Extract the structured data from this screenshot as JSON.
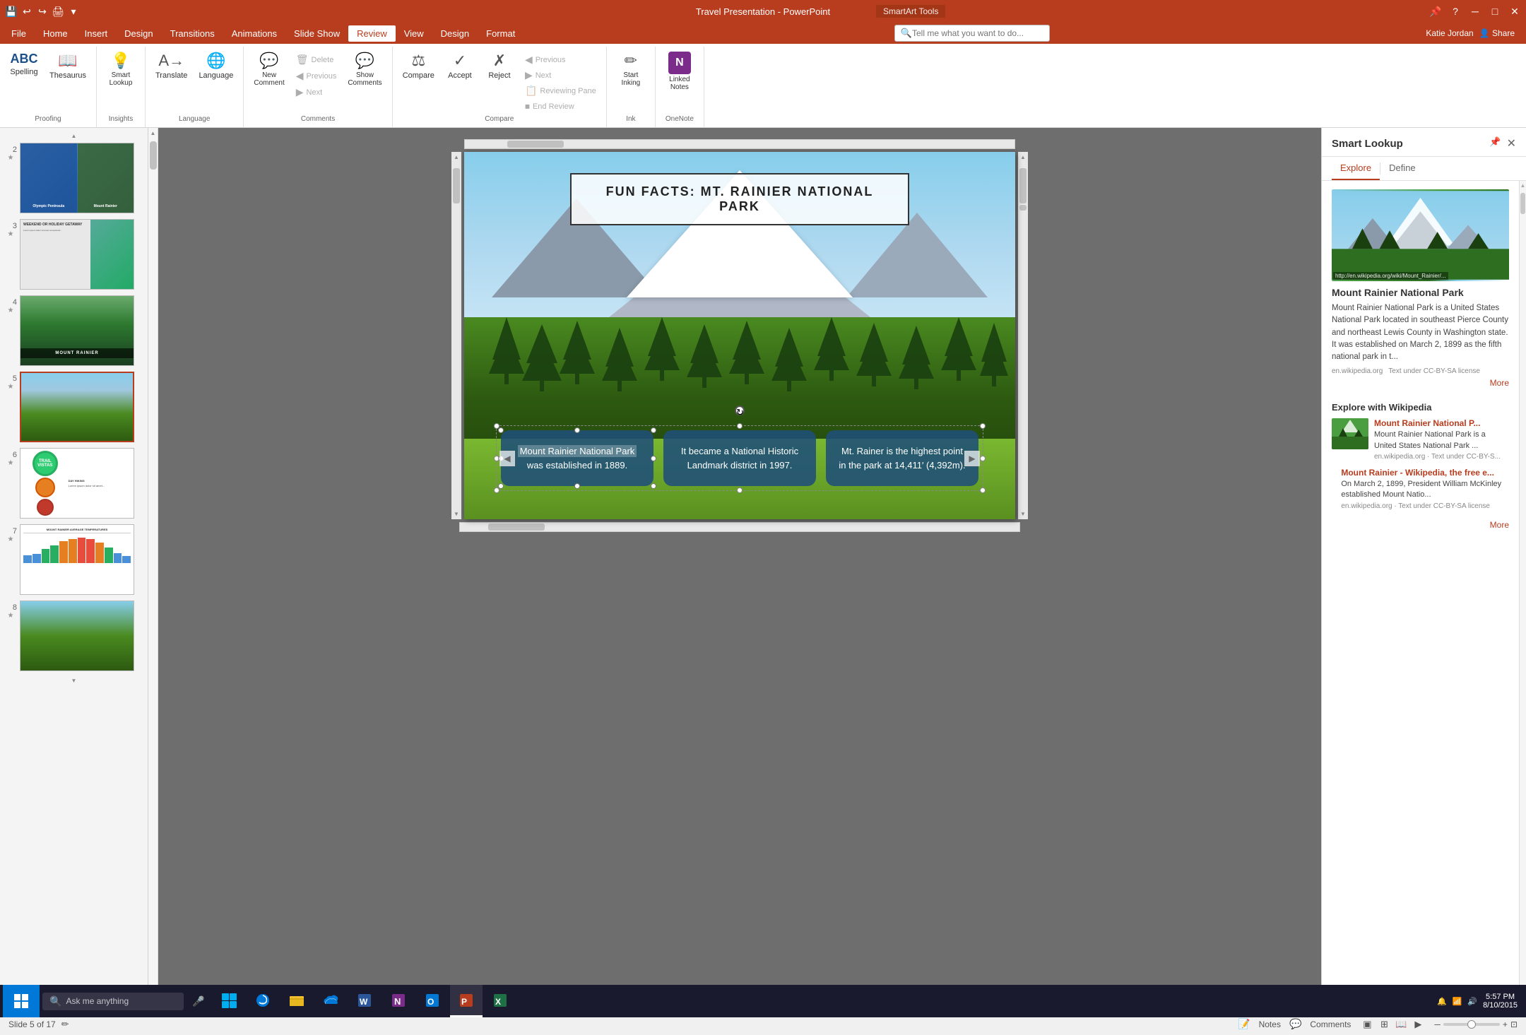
{
  "titlebar": {
    "title": "Travel Presentation - PowerPoint",
    "subtitle": "SmartArt Tools",
    "user": "Katie Jordan",
    "share": "Share",
    "window_controls": [
      "─",
      "□",
      "✕"
    ]
  },
  "menubar": {
    "items": [
      "File",
      "Home",
      "Insert",
      "Design",
      "Transitions",
      "Animations",
      "Slide Show",
      "Review",
      "View",
      "Design",
      "Format"
    ]
  },
  "ribbon": {
    "active_tab": "Review",
    "groups": [
      {
        "label": "Proofing",
        "buttons": [
          {
            "id": "spelling",
            "icon": "ABC",
            "label": "Spelling"
          },
          {
            "id": "thesaurus",
            "icon": "📖",
            "label": "Thesaurus"
          }
        ]
      },
      {
        "label": "Insights",
        "buttons": [
          {
            "id": "smart-lookup",
            "icon": "💡",
            "label": "Smart Lookup"
          }
        ]
      },
      {
        "label": "Language",
        "buttons": [
          {
            "id": "translate",
            "icon": "A→",
            "label": "Translate"
          },
          {
            "id": "language",
            "icon": "🌐",
            "label": "Language"
          }
        ]
      },
      {
        "label": "Comments",
        "buttons": [
          {
            "id": "new-comment",
            "icon": "💬",
            "label": "New Comment"
          },
          {
            "id": "delete",
            "icon": "🗑",
            "label": "Delete"
          },
          {
            "id": "previous",
            "icon": "◀",
            "label": "Previous"
          },
          {
            "id": "next-comment",
            "icon": "▶",
            "label": "Next"
          },
          {
            "id": "show-comments",
            "icon": "💬",
            "label": "Show Comments"
          }
        ]
      },
      {
        "label": "Compare",
        "buttons": [
          {
            "id": "compare",
            "icon": "⚖",
            "label": "Compare"
          },
          {
            "id": "accept",
            "icon": "✓",
            "label": "Accept"
          },
          {
            "id": "reject",
            "icon": "✗",
            "label": "Reject"
          }
        ],
        "small_buttons": [
          {
            "id": "previous-rev",
            "icon": "◀",
            "label": "Previous"
          },
          {
            "id": "next-rev",
            "icon": "▶",
            "label": "Next"
          },
          {
            "id": "reviewing-pane",
            "icon": "📋",
            "label": "Reviewing Pane"
          },
          {
            "id": "end-review",
            "icon": "⏹",
            "label": "End Review"
          }
        ]
      },
      {
        "label": "Ink",
        "buttons": [
          {
            "id": "start-inking",
            "icon": "✏",
            "label": "Start Inking"
          }
        ]
      },
      {
        "label": "OneNote",
        "buttons": [
          {
            "id": "linked-notes",
            "icon": "N",
            "label": "Linked Notes"
          }
        ]
      }
    ],
    "search_placeholder": "Tell me what you want to do...",
    "user_name": "Katie Jordan"
  },
  "slides": [
    {
      "num": "2",
      "star": "★",
      "type": "slide2"
    },
    {
      "num": "3",
      "star": "★",
      "type": "slide3"
    },
    {
      "num": "4",
      "star": "★",
      "type": "slide4"
    },
    {
      "num": "5",
      "star": "★",
      "type": "slide5",
      "active": true
    },
    {
      "num": "6",
      "star": "★",
      "type": "slide6"
    },
    {
      "num": "7",
      "star": "★",
      "type": "slide7"
    },
    {
      "num": "8",
      "star": "★",
      "type": "slide8"
    }
  ],
  "current_slide": {
    "title": "FUN FACTS: MT. RAINIER NATIONAL PARK",
    "cards": [
      {
        "id": "card1",
        "text_highlighted": "Mount Rainier National Park",
        "text_rest": " was  established in 1889."
      },
      {
        "id": "card2",
        "text": "It became a National Historic Landmark district in 1997."
      },
      {
        "id": "card3",
        "text": "Mt. Rainer is the highest point in the park at 14,411′ (4,392m)."
      }
    ]
  },
  "smart_lookup": {
    "title": "Smart Lookup",
    "tabs": [
      "Explore",
      "Define"
    ],
    "active_tab": "Explore",
    "image_caption": "http://en.wikipedia.org/wiki/Mount_Rainier/...",
    "wiki_title": "Mount Rainier National Park",
    "wiki_text": "Mount Rainier National Park is a United States National Park located in southeast Pierce County and northeast Lewis County in Washington state. It was established on March 2, 1899 as the fifth national park in t...",
    "wiki_source": "en.wikipedia.org",
    "wiki_license": "Text under CC-BY-SA license",
    "more_label": "More",
    "explore_title": "Explore with Wikipedia",
    "results": [
      {
        "title": "Mount Rainier National P...",
        "desc": "Mount Rainier National Park is a United States National Park ...",
        "source": "en.wikipedia.org · Text under CC-BY-S..."
      },
      {
        "title": "Mount Rainier - Wikipedia, the free e...",
        "desc": "On March 2, 1899, President William McKinley established Mount Natio...",
        "source": "en.wikipedia.org · Text under CC-BY-SA license"
      }
    ],
    "more_label2": "More"
  },
  "statusbar": {
    "slide_info": "Slide 5 of 17",
    "notes": "Notes",
    "comments": "Comments",
    "zoom": "─",
    "time": "5:57 PM",
    "date": "8/10/2015"
  },
  "taskbar": {
    "search_placeholder": "Ask me anything",
    "time": "5:57 PM",
    "date": "8/10/2015"
  }
}
